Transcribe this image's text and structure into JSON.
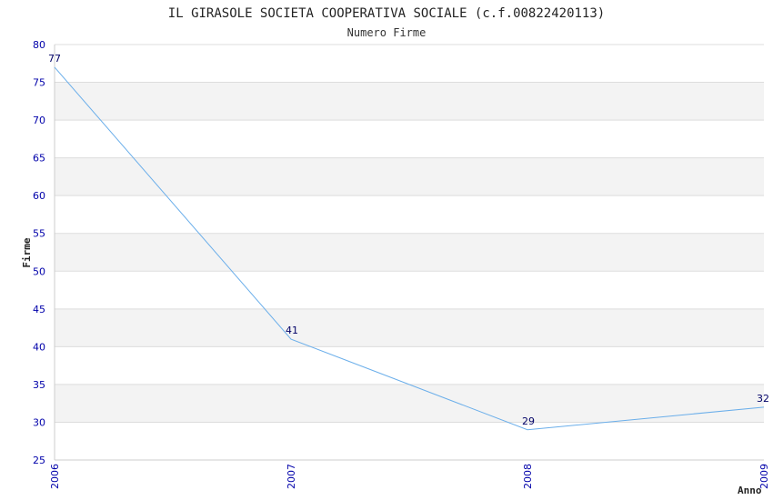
{
  "chart_data": {
    "type": "line",
    "title": "IL GIRASOLE SOCIETA COOPERATIVA SOCIALE (c.f.00822420113)",
    "subtitle": "Numero Firme",
    "xlabel": "Anno",
    "ylabel": "Firme",
    "categories": [
      "2006",
      "2007",
      "2008",
      "2009"
    ],
    "values": [
      77,
      41,
      29,
      32
    ],
    "data_labels": [
      "77",
      "41",
      "29",
      "32"
    ],
    "yticks": [
      25,
      30,
      35,
      40,
      45,
      50,
      55,
      60,
      65,
      70,
      75,
      80
    ],
    "ylim": [
      25,
      80
    ],
    "grid": "horizontal alternating bands",
    "colors": {
      "line": "#6aaeea",
      "band": "#f3f3f3",
      "gridline": "#dddddd",
      "tick_text": "#0000aa"
    }
  }
}
